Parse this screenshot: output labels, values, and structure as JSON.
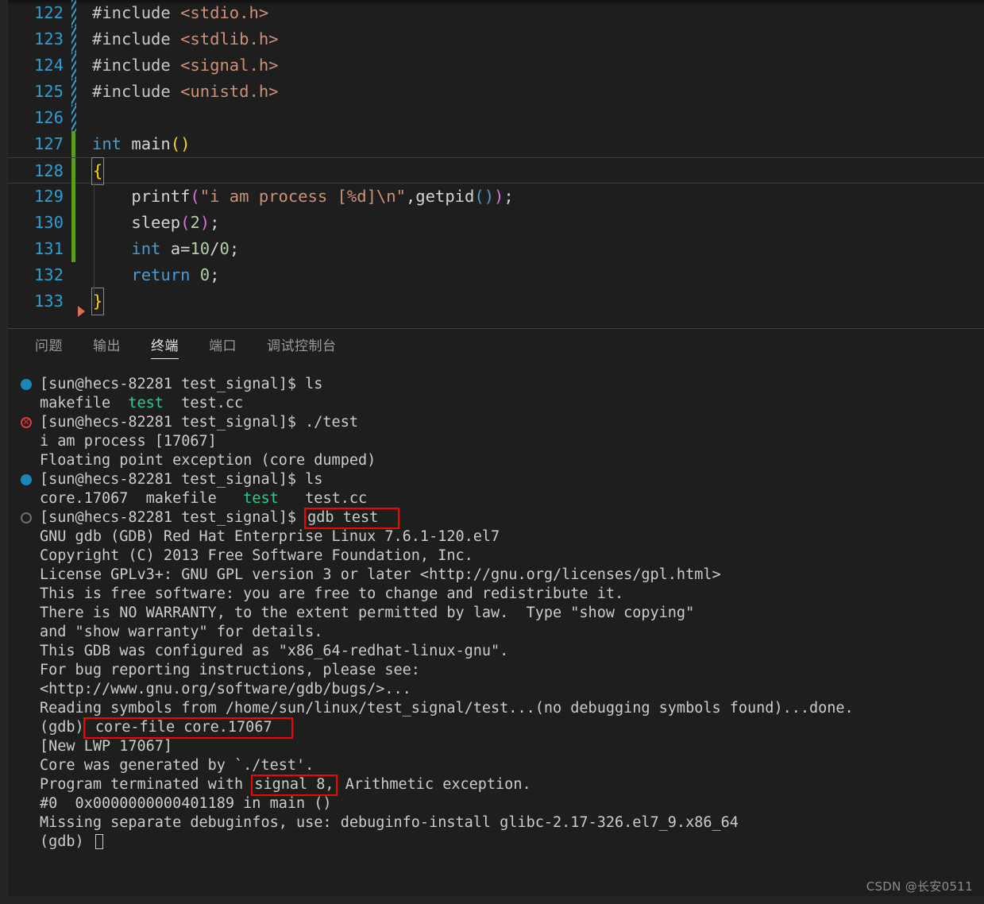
{
  "editor": {
    "lines": [
      {
        "num": "122",
        "gutter": "striped",
        "current": false,
        "tokens": [
          {
            "t": "#include ",
            "c": "t-pre"
          },
          {
            "t": "<stdio.h>",
            "c": "t-str"
          }
        ]
      },
      {
        "num": "123",
        "gutter": "striped",
        "current": false,
        "tokens": [
          {
            "t": "#include ",
            "c": "t-pre"
          },
          {
            "t": "<stdlib.h>",
            "c": "t-str"
          }
        ]
      },
      {
        "num": "124",
        "gutter": "striped",
        "current": false,
        "tokens": [
          {
            "t": "#include ",
            "c": "t-pre"
          },
          {
            "t": "<signal.h>",
            "c": "t-str"
          }
        ]
      },
      {
        "num": "125",
        "gutter": "striped",
        "current": false,
        "tokens": [
          {
            "t": "#include ",
            "c": "t-pre"
          },
          {
            "t": "<unistd.h>",
            "c": "t-str"
          }
        ]
      },
      {
        "num": "126",
        "gutter": "striped",
        "current": false,
        "tokens": []
      },
      {
        "num": "127",
        "gutter": "green",
        "current": false,
        "tokens": [
          {
            "t": "int ",
            "c": "t-kw"
          },
          {
            "t": "main",
            "c": "t-plain"
          },
          {
            "t": "()",
            "c": "t-paren1"
          }
        ]
      },
      {
        "num": "128",
        "gutter": "green",
        "current": true,
        "tokens": [
          {
            "t": "{",
            "c": "t-brace",
            "box": true
          }
        ]
      },
      {
        "num": "129",
        "gutter": "green",
        "current": false,
        "tokens": [
          {
            "t": "    printf",
            "c": "t-plain"
          },
          {
            "t": "(",
            "c": "t-paren2"
          },
          {
            "t": "\"i am process [%d]\\n\"",
            "c": "t-str"
          },
          {
            "t": ",",
            "c": "t-plain"
          },
          {
            "t": "getpid",
            "c": "t-plain"
          },
          {
            "t": "(",
            "c": "t-paren3"
          },
          {
            "t": ")",
            "c": "t-paren3"
          },
          {
            "t": ")",
            "c": "t-paren2"
          },
          {
            "t": ";",
            "c": "t-plain"
          }
        ]
      },
      {
        "num": "130",
        "gutter": "green",
        "current": false,
        "tokens": [
          {
            "t": "    sleep",
            "c": "t-plain"
          },
          {
            "t": "(",
            "c": "t-paren2"
          },
          {
            "t": "2",
            "c": "t-num"
          },
          {
            "t": ")",
            "c": "t-paren2"
          },
          {
            "t": ";",
            "c": "t-plain"
          }
        ]
      },
      {
        "num": "131",
        "gutter": "green",
        "current": false,
        "tokens": [
          {
            "t": "    int ",
            "c": "t-kw"
          },
          {
            "t": "a=",
            "c": "t-plain"
          },
          {
            "t": "10",
            "c": "t-num"
          },
          {
            "t": "/",
            "c": "t-plain"
          },
          {
            "t": "0",
            "c": "t-num"
          },
          {
            "t": ";",
            "c": "t-plain"
          }
        ]
      },
      {
        "num": "132",
        "gutter": "none",
        "current": false,
        "tokens": [
          {
            "t": "    return ",
            "c": "t-kw"
          },
          {
            "t": "0",
            "c": "t-num"
          },
          {
            "t": ";",
            "c": "t-plain"
          }
        ]
      },
      {
        "num": "133",
        "gutter": "none",
        "current": false,
        "arrow": true,
        "tokens": [
          {
            "t": "}",
            "c": "t-brace",
            "box": true
          }
        ]
      }
    ]
  },
  "panel": {
    "tabs": [
      {
        "label": "问题",
        "active": false
      },
      {
        "label": "输出",
        "active": false
      },
      {
        "label": "终端",
        "active": true
      },
      {
        "label": "端口",
        "active": false
      },
      {
        "label": "调试控制台",
        "active": false
      }
    ]
  },
  "terminal": {
    "lines": [
      {
        "mark": "dot-blue",
        "parts": [
          {
            "t": "[sun@hecs-82281 test_signal]$ ls"
          }
        ]
      },
      {
        "mark": "none",
        "parts": [
          {
            "t": "makefile  "
          },
          {
            "t": "test",
            "c": "sh-green"
          },
          {
            "t": "  test.cc"
          }
        ]
      },
      {
        "mark": "err",
        "parts": [
          {
            "t": "[sun@hecs-82281 test_signal]$ ./test"
          }
        ]
      },
      {
        "mark": "none",
        "parts": [
          {
            "t": "i am process [17067]"
          }
        ]
      },
      {
        "mark": "none",
        "parts": [
          {
            "t": "Floating point exception (core dumped)"
          }
        ]
      },
      {
        "mark": "dot-blue",
        "parts": [
          {
            "t": "[sun@hecs-82281 test_signal]$ ls"
          }
        ]
      },
      {
        "mark": "none",
        "parts": [
          {
            "t": "core.17067  makefile   "
          },
          {
            "t": "test",
            "c": "sh-green"
          },
          {
            "t": "   test.cc"
          }
        ]
      },
      {
        "mark": "circle-open",
        "parts": [
          {
            "t": "[sun@hecs-82281 test_signal]$ "
          },
          {
            "t": "gdb test  ",
            "box": true
          }
        ]
      },
      {
        "mark": "none",
        "parts": [
          {
            "t": "GNU gdb (GDB) Red Hat Enterprise Linux 7.6.1-120.el7"
          }
        ]
      },
      {
        "mark": "none",
        "parts": [
          {
            "t": "Copyright (C) 2013 Free Software Foundation, Inc."
          }
        ]
      },
      {
        "mark": "none",
        "parts": [
          {
            "t": "License GPLv3+: GNU GPL version 3 or later <http://gnu.org/licenses/gpl.html>"
          }
        ]
      },
      {
        "mark": "none",
        "parts": [
          {
            "t": "This is free software: you are free to change and redistribute it."
          }
        ]
      },
      {
        "mark": "none",
        "parts": [
          {
            "t": "There is NO WARRANTY, to the extent permitted by law.  Type \"show copying\""
          }
        ]
      },
      {
        "mark": "none",
        "parts": [
          {
            "t": "and \"show warranty\" for details."
          }
        ]
      },
      {
        "mark": "none",
        "parts": [
          {
            "t": "This GDB was configured as \"x86_64-redhat-linux-gnu\"."
          }
        ]
      },
      {
        "mark": "none",
        "parts": [
          {
            "t": "For bug reporting instructions, please see:"
          }
        ]
      },
      {
        "mark": "none",
        "parts": [
          {
            "t": "<http://www.gnu.org/software/gdb/bugs/>..."
          }
        ]
      },
      {
        "mark": "none",
        "parts": [
          {
            "t": "Reading symbols from /home/sun/linux/test_signal/test...(no debugging symbols found)...done."
          }
        ]
      },
      {
        "mark": "none",
        "parts": [
          {
            "t": "(gdb)"
          },
          {
            "t": " core-file core.17067  ",
            "box": true
          }
        ]
      },
      {
        "mark": "none",
        "parts": [
          {
            "t": "[New LWP 17067]"
          }
        ]
      },
      {
        "mark": "none",
        "parts": [
          {
            "t": "Core was generated by `./test'."
          }
        ]
      },
      {
        "mark": "none",
        "parts": [
          {
            "t": "Program terminated with "
          },
          {
            "t": "signal 8,",
            "box": true
          },
          {
            "t": " Arithmetic exception."
          }
        ]
      },
      {
        "mark": "none",
        "parts": [
          {
            "t": "#0  0x0000000000401189 in main ()"
          }
        ]
      },
      {
        "mark": "none",
        "parts": [
          {
            "t": "Missing separate debuginfos, use: debuginfo-install glibc-2.17-326.el7_9.x86_64"
          }
        ]
      },
      {
        "mark": "none",
        "parts": [
          {
            "t": "(gdb) "
          },
          {
            "t": "",
            "cursor": true
          }
        ]
      }
    ]
  },
  "watermark": {
    "text": "CSDN @长安0511"
  }
}
